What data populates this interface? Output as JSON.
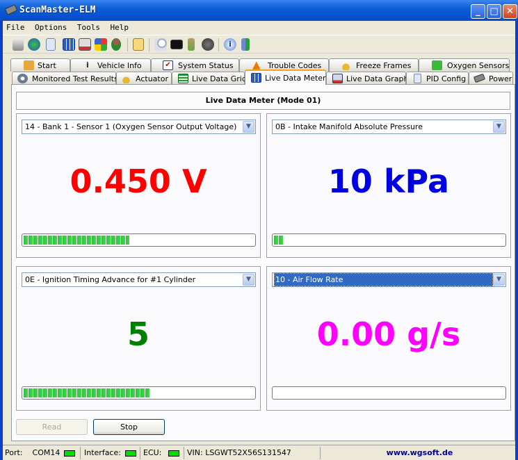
{
  "window": {
    "title": "ScanMaster-ELM",
    "minimize": "_",
    "maximize": "□",
    "close": "✕"
  },
  "menu": [
    "File",
    "Options",
    "Tools",
    "Help"
  ],
  "toolbar_icons": [
    "connect-icon",
    "globe-icon",
    "report-icon",
    "grid-icon",
    "graph-icon",
    "colors-icon",
    "user-icon",
    "clipboard-icon",
    "search-icon",
    "terminal-icon",
    "battery-icon",
    "gauge-icon",
    "info-icon",
    "exit-icon"
  ],
  "tabs_row1": [
    {
      "label": "Start",
      "icon": "home-icon"
    },
    {
      "label": "Vehicle Info",
      "icon": "info-icon"
    },
    {
      "label": "System Status",
      "icon": "checkbox-icon"
    },
    {
      "label": "Trouble Codes",
      "icon": "warning-icon"
    },
    {
      "label": "Freeze Frames",
      "icon": "joystick-icon"
    },
    {
      "label": "Oxygen Sensors",
      "icon": "sensor-icon"
    }
  ],
  "tabs_row2": [
    {
      "label": "Monitored Test Results",
      "icon": "gear-icon"
    },
    {
      "label": "Actuator",
      "icon": "joystick-icon"
    },
    {
      "label": "Live Data Grid",
      "icon": "list-icon"
    },
    {
      "label": "Live Data Meter",
      "icon": "grid-icon",
      "active": true
    },
    {
      "label": "Live Data Graph",
      "icon": "graph-icon"
    },
    {
      "label": "PID Config",
      "icon": "config-icon"
    },
    {
      "label": "Power",
      "icon": "chip-icon"
    }
  ],
  "panel": {
    "header": "Live Data Meter (Mode 01)"
  },
  "meters": [
    {
      "pid": "14 - Bank 1 - Sensor 1 (Oxygen Sensor Output Voltage)",
      "value": "0.450 V",
      "color": "#ff0000",
      "progress": 0.46
    },
    {
      "pid": "0B - Intake Manifold Absolute Pressure",
      "value": "10 kPa",
      "color": "#0000e0",
      "progress": 0.04
    },
    {
      "pid": "0E - Ignition Timing Advance for #1 Cylinder",
      "value": "5",
      "color": "#008000",
      "progress": 0.55
    },
    {
      "pid": "10 - Air Flow Rate",
      "value": "0.00 g/s",
      "color": "#ff00ff",
      "progress": 0.0,
      "focused": true
    }
  ],
  "buttons": {
    "read": "Read",
    "stop": "Stop"
  },
  "status": {
    "port_label": "Port:",
    "port": "COM14",
    "interface_label": "Interface:",
    "ecu_label": "ECU:",
    "vin": "VIN: LSGWT52X56S131547",
    "website": "www.wgsoft.de"
  }
}
